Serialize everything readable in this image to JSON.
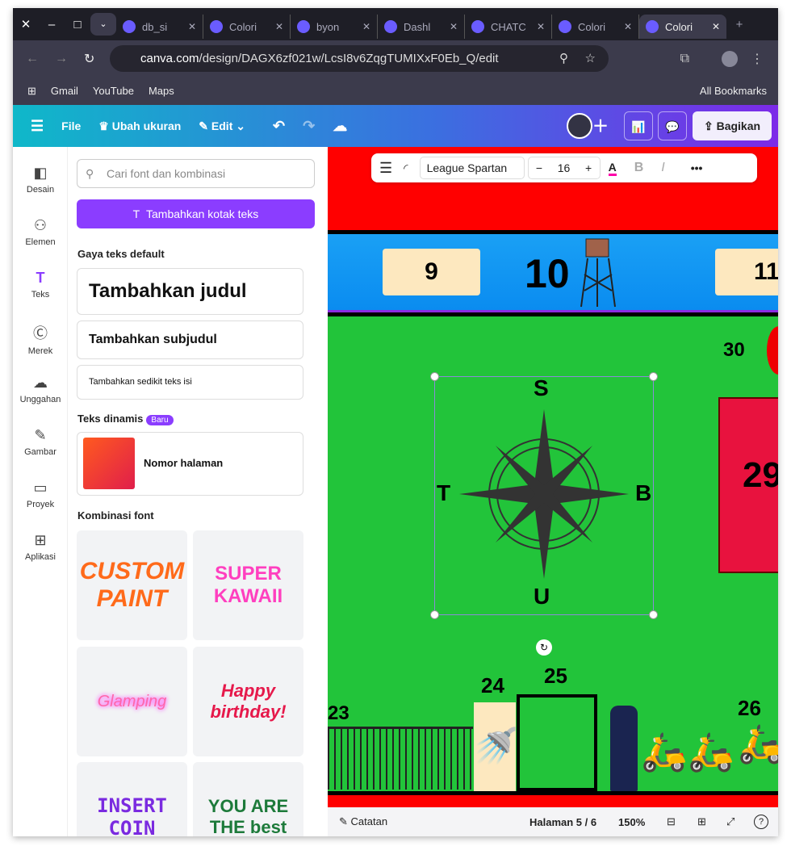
{
  "browser": {
    "tabs": [
      {
        "label": "db_si",
        "icon": "share-icon"
      },
      {
        "label": "Colori",
        "icon": "canva-icon"
      },
      {
        "label": "byon",
        "icon": "x-icon"
      },
      {
        "label": "Dashl",
        "icon": "c-icon"
      },
      {
        "label": "CHATC",
        "icon": "docs-icon"
      },
      {
        "label": "Colori",
        "icon": "canva-icon"
      },
      {
        "label": "Colori",
        "icon": "canva-icon",
        "active": true
      }
    ],
    "url_host": "canva.com",
    "url_path": "/design/DAGX6zf021w/LcsI8v6ZqgTUMIXxF0Eb_Q/edit",
    "bookmarks": [
      "Gmail",
      "YouTube",
      "Maps"
    ],
    "all_bookmarks": "All Bookmarks"
  },
  "header": {
    "file": "File",
    "resize": "Ubah ukuran",
    "edit": "Edit",
    "share": "Bagikan"
  },
  "rail": [
    "Desain",
    "Elemen",
    "Teks",
    "Merek",
    "Unggahan",
    "Gambar",
    "Proyek",
    "Aplikasi"
  ],
  "panel": {
    "search_placeholder": "Cari font dan kombinasi",
    "add_text": "Tambahkan kotak teks",
    "default_styles": "Gaya teks default",
    "heading": "Tambahkan judul",
    "subheading": "Tambahkan subjudul",
    "body": "Tambahkan sedikit teks isi",
    "dynamic": "Teks dinamis",
    "new_badge": "Baru",
    "page_number": "Nomor halaman",
    "combos": "Kombinasi font",
    "tiles": [
      "CUSTOM PAINT",
      "SUPER KAWAII",
      "Glamping",
      "Happy birthday!",
      "INSERT COIN",
      "YOU ARE THE best"
    ]
  },
  "text_toolbar": {
    "font": "League Spartan",
    "size": "16",
    "bold": "B",
    "italic": "I"
  },
  "design": {
    "numbers": [
      "9",
      "10",
      "11",
      "30",
      "29",
      "23",
      "24",
      "25",
      "26"
    ],
    "compass": {
      "north": "S",
      "south": "U",
      "west": "T",
      "east": "B"
    },
    "colors": {
      "red": "#ff0000",
      "blue": "#0a8cf0",
      "green": "#22c43a"
    }
  },
  "footer": {
    "notes": "Catatan",
    "page": "Halaman 5 / 6",
    "zoom": "150%"
  }
}
